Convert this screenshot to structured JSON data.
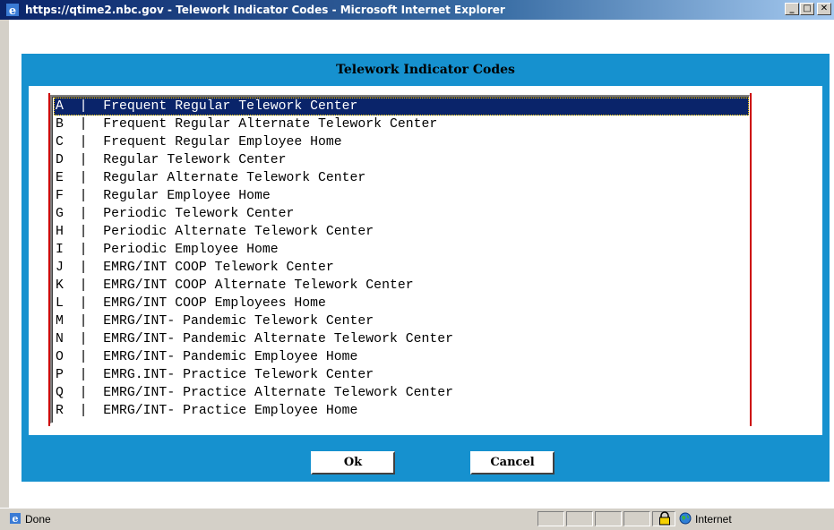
{
  "window": {
    "title": "https://qtime2.nbc.gov - Telework Indicator Codes - Microsoft Internet Explorer",
    "min_label": "_",
    "max_label": "□",
    "close_label": "✕"
  },
  "dialog": {
    "heading": "Telework Indicator Codes",
    "items": [
      "A  |  Frequent Regular Telework Center",
      "B  |  Frequent Regular Alternate Telework Center",
      "C  |  Frequent Regular Employee Home",
      "D  |  Regular Telework Center",
      "E  |  Regular Alternate Telework Center",
      "F  |  Regular Employee Home",
      "G  |  Periodic Telework Center",
      "H  |  Periodic Alternate Telework Center",
      "I  |  Periodic Employee Home",
      "J  |  EMRG/INT COOP Telework Center",
      "K  |  EMRG/INT COOP Alternate Telework Center",
      "L  |  EMRG/INT COOP Employees Home",
      "M  |  EMRG/INT- Pandemic Telework Center",
      "N  |  EMRG/INT- Pandemic Alternate Telework Center",
      "O  |  EMRG/INT- Pandemic Employee Home",
      "P  |  EMRG.INT- Practice Telework Center",
      "Q  |  EMRG/INT- Practice Alternate Telework Center",
      "R  |  EMRG/INT- Practice Employee Home"
    ],
    "selected_index": 0,
    "ok_label": "Ok",
    "cancel_label": "Cancel"
  },
  "statusbar": {
    "status": "Done",
    "zone": "Internet"
  },
  "colors": {
    "panel": "#1691cf",
    "selection": "#0a246a",
    "red_rule": "#cc0000"
  }
}
